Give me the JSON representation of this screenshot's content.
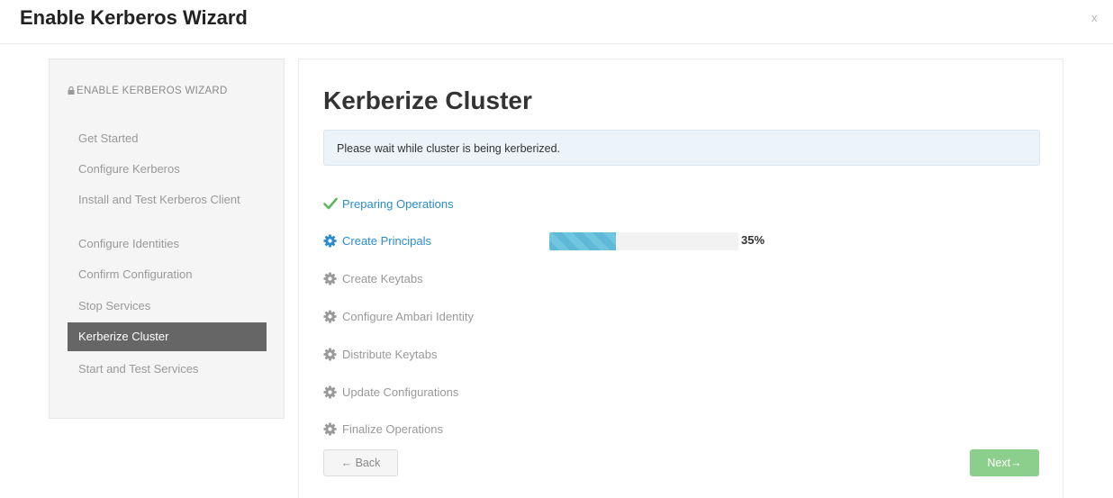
{
  "modal": {
    "title": "Enable Kerberos Wizard",
    "close_label": "x"
  },
  "sidebar": {
    "header": "ENABLE KERBEROS WIZARD",
    "items": [
      {
        "label": "Get Started"
      },
      {
        "label": "Configure Kerberos"
      },
      {
        "label": "Install and Test Kerberos Client"
      },
      {
        "label": "Configure Identities"
      },
      {
        "label": "Confirm Configuration"
      },
      {
        "label": "Stop Services"
      },
      {
        "label": "Kerberize Cluster",
        "active": true
      },
      {
        "label": "Start and Test Services"
      }
    ]
  },
  "main": {
    "title": "Kerberize Cluster",
    "alert": "Please wait while cluster is being kerberized.",
    "steps": [
      {
        "label": "Preparing Operations",
        "status": "done",
        "icon": "check-icon"
      },
      {
        "label": "Create Principals",
        "status": "running",
        "icon": "gear-icon"
      },
      {
        "label": "Create Keytabs",
        "status": "pending",
        "icon": "gear-icon"
      },
      {
        "label": "Configure Ambari Identity",
        "status": "pending",
        "icon": "gear-icon"
      },
      {
        "label": "Distribute Keytabs",
        "status": "pending",
        "icon": "gear-icon"
      },
      {
        "label": "Update Configurations",
        "status": "pending",
        "icon": "gear-icon"
      },
      {
        "label": "Finalize Operations",
        "status": "pending",
        "icon": "gear-icon"
      }
    ],
    "progress": {
      "value": 0.35,
      "label": "35%"
    },
    "back_button": "← Back",
    "next_button": "Next→"
  },
  "colors": {
    "accent_blue": "#2a8ccc",
    "success_green": "#5cb85c",
    "active_sidebar": "#666666",
    "progress_fill": "#5fb9d6",
    "next_disabled": "#8ccf8c"
  }
}
